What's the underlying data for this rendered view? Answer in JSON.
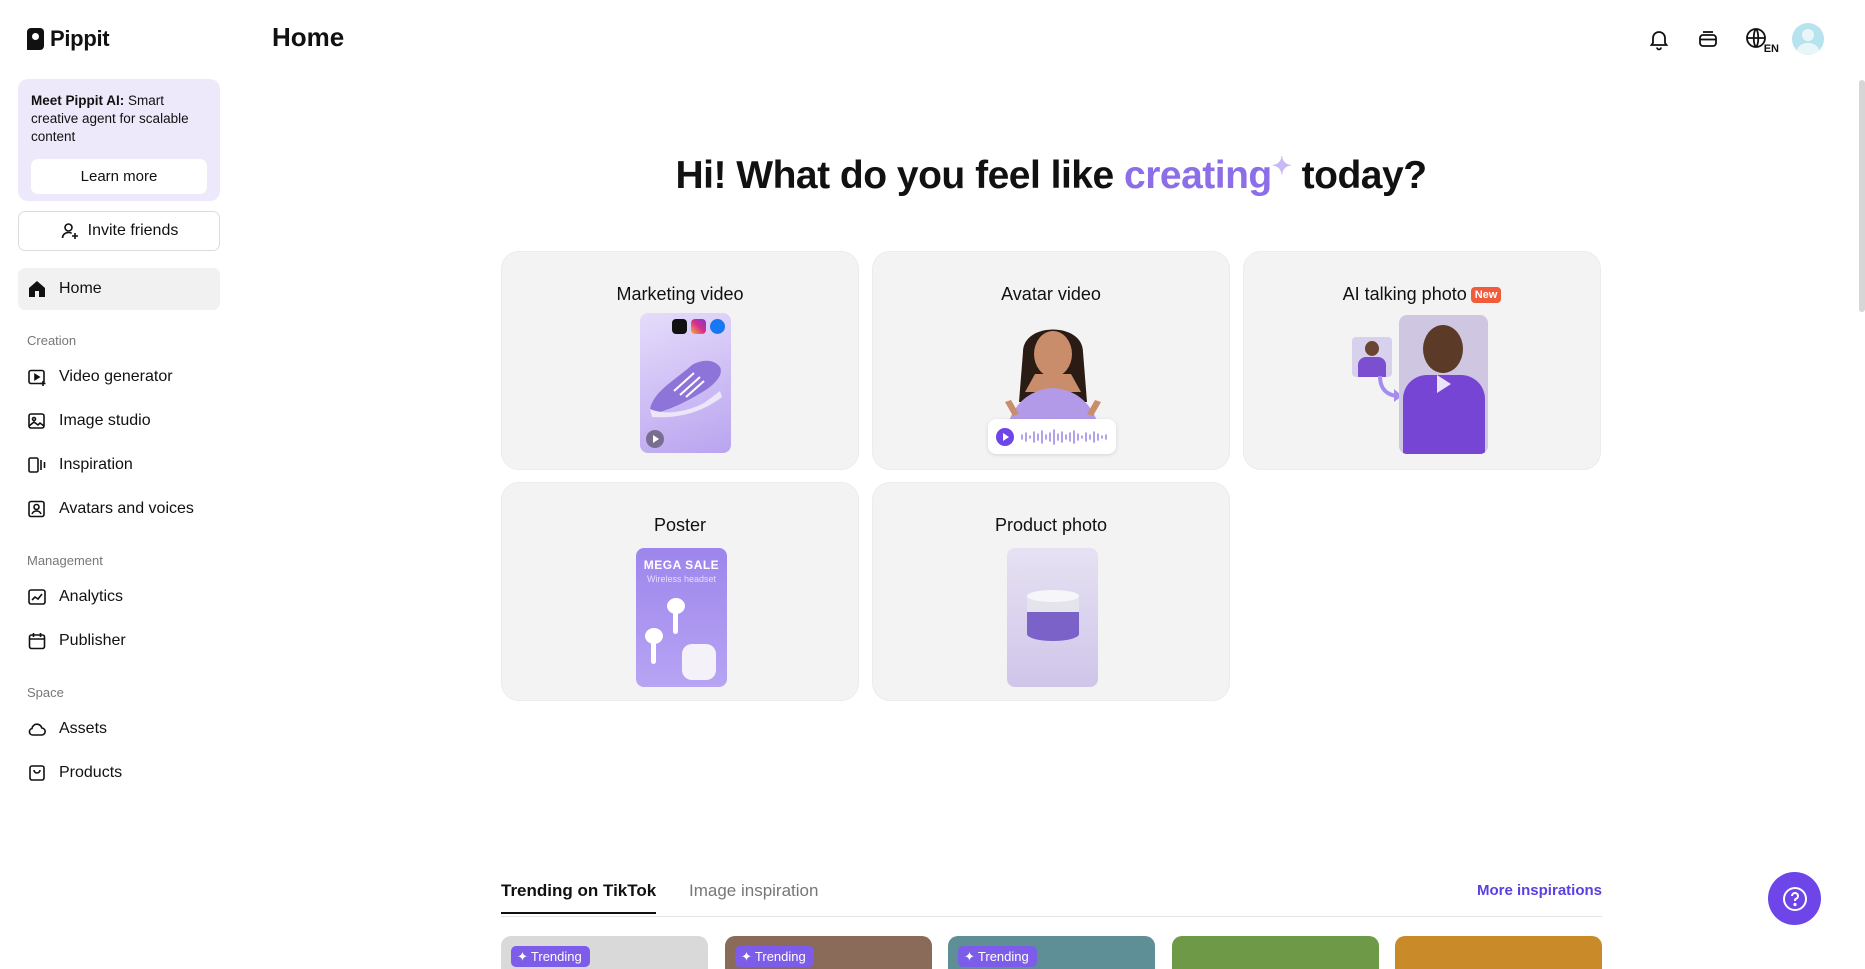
{
  "brand": {
    "name": "Pippit"
  },
  "sidebar": {
    "promo": {
      "bold": "Meet Pippit AI:",
      "text": " Smart creative agent for scalable content",
      "button": "Learn more"
    },
    "invite": "Invite friends",
    "home": "Home",
    "sections": [
      {
        "label": "Creation",
        "items": [
          "Video generator",
          "Image studio",
          "Inspiration",
          "Avatars and voices"
        ]
      },
      {
        "label": "Management",
        "items": [
          "Analytics",
          "Publisher"
        ]
      },
      {
        "label": "Space",
        "items": [
          "Assets",
          "Products"
        ]
      }
    ]
  },
  "header": {
    "title": "Home",
    "lang": "EN"
  },
  "hero": {
    "before": "Hi! What do you feel like ",
    "accent": "creating",
    "after": " today?"
  },
  "cards": [
    {
      "title": "Marketing video"
    },
    {
      "title": "Avatar video"
    },
    {
      "title": "AI talking photo",
      "badge": "New"
    },
    {
      "title": "Poster",
      "poster_headline": "MEGA SALE",
      "poster_sub": "Wireless headset"
    },
    {
      "title": "Product photo"
    }
  ],
  "tabs": {
    "items": [
      "Trending on TikTok",
      "Image inspiration"
    ],
    "more": "More inspirations"
  },
  "trending": {
    "badge": "Trending",
    "cards": [
      {
        "color": "#d9d9d9",
        "badge": true
      },
      {
        "color": "#8a6a58",
        "badge": true
      },
      {
        "color": "#5e8f96",
        "badge": true
      },
      {
        "color": "#6e9a48",
        "badge": false
      },
      {
        "color": "#c98a2a",
        "badge": false
      }
    ]
  },
  "colors": {
    "accent": "#8c6ee8",
    "brand_purple": "#6d45e8",
    "promo_bg": "#ede9fb"
  }
}
